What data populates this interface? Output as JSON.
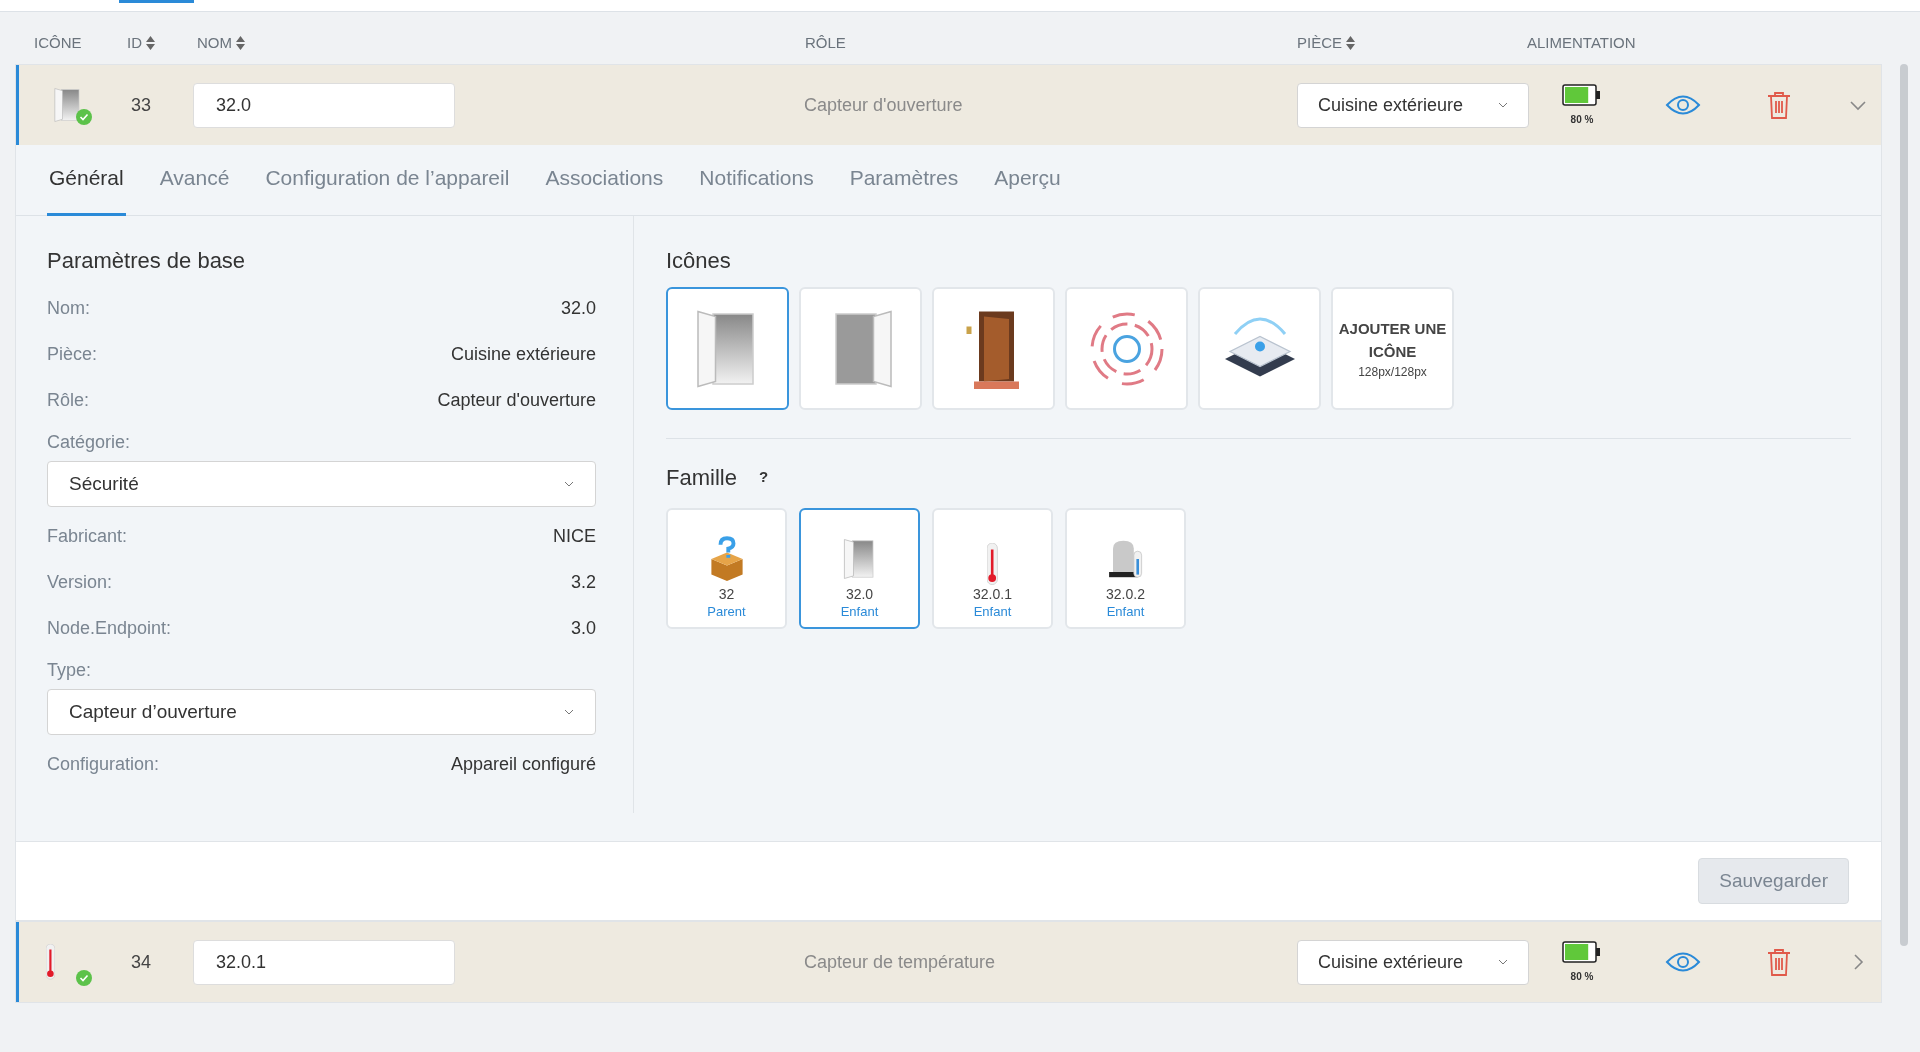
{
  "columns": [
    {
      "label": "ICÔNE",
      "sortable": false
    },
    {
      "label": "ID",
      "sortable": true
    },
    {
      "label": "NOM",
      "sortable": true
    },
    {
      "label": "RÔLE",
      "sortable": false
    },
    {
      "label": "PIÈCE",
      "sortable": true
    },
    {
      "label": "ALIMENTATION",
      "sortable": false
    }
  ],
  "devices": [
    {
      "kind": "door",
      "id": "33",
      "name": "32.0",
      "role": "Capteur d'ouverture",
      "room": "Cuisine extérieure",
      "level": 0.8,
      "battery": "80 %",
      "expanded": true,
      "tabs": [
        {
          "label": "Général",
          "selected": true
        },
        {
          "label": "Avancé",
          "selected": false
        },
        {
          "label": "Configuration de l’appareil",
          "selected": false
        },
        {
          "label": "Associations",
          "selected": false
        },
        {
          "label": "Notifications",
          "selected": false
        },
        {
          "label": "Paramètres",
          "selected": false
        },
        {
          "label": "Aperçu",
          "selected": false
        }
      ],
      "basic": {
        "title": "Paramètres de base",
        "fields": [
          {
            "kind": "text",
            "label": "Nom:",
            "value": "32.0"
          },
          {
            "kind": "text",
            "label": "Pièce:",
            "value": "Cuisine extérieure"
          },
          {
            "kind": "text",
            "label": "Rôle:",
            "value": "Capteur d'ouverture"
          },
          {
            "kind": "select",
            "label": "Catégorie:",
            "value": "Sécurité"
          },
          {
            "kind": "text",
            "label": "Fabricant:",
            "value": "NICE"
          },
          {
            "kind": "text",
            "label": "Version:",
            "value": "3.2"
          },
          {
            "kind": "text",
            "label": "Node.Endpoint:",
            "value": "3.0"
          },
          {
            "kind": "select",
            "label": "Type:",
            "value": "Capteur d’ouverture"
          },
          {
            "kind": "text",
            "label": "Configuration:",
            "value": "Appareil configuré"
          }
        ]
      },
      "icons": {
        "title": "Icônes",
        "items": [
          {
            "kind": "door",
            "selected": true
          },
          {
            "kind": "door-right",
            "selected": false
          },
          {
            "kind": "wooden-door",
            "selected": false
          },
          {
            "kind": "rings",
            "selected": false
          },
          {
            "kind": "hub",
            "selected": false
          }
        ],
        "add": {
          "title": "AJOUTER UNE ICÔNE",
          "size": "128px/128px"
        }
      },
      "family": {
        "title": "Famille",
        "help": "?",
        "members": [
          {
            "kind": "box",
            "id": "32",
            "relation": "Parent",
            "selected": false
          },
          {
            "kind": "door",
            "id": "32.0",
            "relation": "Enfant",
            "selected": true
          },
          {
            "kind": "thermometer",
            "id": "32.0.1",
            "relation": "Enfant",
            "selected": false
          },
          {
            "kind": "siren",
            "id": "32.0.2",
            "relation": "Enfant",
            "selected": false
          }
        ]
      },
      "save": "Sauvegarder"
    },
    {
      "kind": "thermometer",
      "id": "34",
      "name": "32.0.1",
      "role": "Capteur de température",
      "room": "Cuisine extérieure",
      "level": 0.8,
      "battery": "80 %",
      "expanded": false
    }
  ]
}
